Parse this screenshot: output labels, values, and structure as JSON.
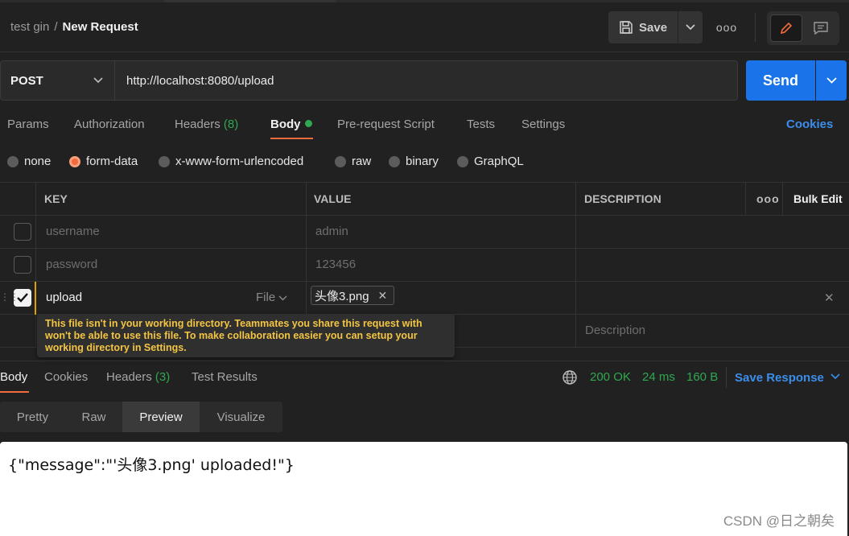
{
  "breadcrumb": {
    "collection": "test gin",
    "separator": "/",
    "request": "New Request"
  },
  "header": {
    "save_label": "Save",
    "more": "ooo"
  },
  "request": {
    "method": "POST",
    "url": "http://localhost:8080/upload",
    "send_label": "Send"
  },
  "tabs": {
    "params": "Params",
    "authorization": "Authorization",
    "headers": "Headers",
    "headers_count": "(8)",
    "body": "Body",
    "prerequest": "Pre-request Script",
    "tests": "Tests",
    "settings": "Settings",
    "cookies": "Cookies"
  },
  "body_types": [
    "none",
    "form-data",
    "x-www-form-urlencoded",
    "raw",
    "binary",
    "GraphQL"
  ],
  "table": {
    "key_header": "KEY",
    "value_header": "VALUE",
    "description_header": "DESCRIPTION",
    "more": "ooo",
    "bulk_edit": "Bulk Edit",
    "rows": [
      {
        "key": "username",
        "value": "admin"
      },
      {
        "key": "password",
        "value": "123456"
      },
      {
        "key": "upload",
        "type_label": "File",
        "file": "头像3.png"
      }
    ],
    "description_placeholder": "Description"
  },
  "tooltip": "This file isn't in your working directory. Teammates you share this request with won't be able to use this file. To make collaboration easier you can setup your working directory in Settings.",
  "response": {
    "tabs": {
      "body": "Body",
      "cookies": "Cookies",
      "headers": "Headers",
      "headers_count": "(3)",
      "test_results": "Test Results"
    },
    "status": "200 OK",
    "time": "24 ms",
    "size": "160 B",
    "save_response": "Save Response",
    "views": [
      "Pretty",
      "Raw",
      "Preview",
      "Visualize"
    ],
    "preview_text": "{\"message\":\"'头像3.png' uploaded!\"}"
  },
  "watermark": "CSDN @日之朝矣",
  "colors": {
    "accent": "#f26b3a",
    "primary": "#1a73e8",
    "success": "#2fa84f",
    "warning": "#f4c542"
  }
}
